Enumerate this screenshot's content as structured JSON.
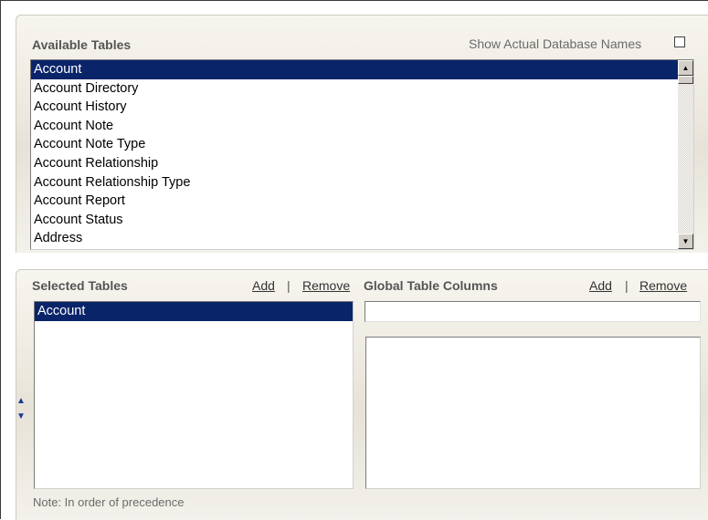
{
  "available_tables": {
    "heading": "Available Tables",
    "show_db_names_label": "Show Actual Database Names",
    "show_db_names_checked": false,
    "items": [
      "Account",
      "Account Directory",
      "Account History",
      "Account Note",
      "Account Note Type",
      "Account Relationship",
      "Account Relationship Type",
      "Account Report",
      "Account Status",
      "Address"
    ],
    "selected_index": 0
  },
  "selected_tables": {
    "heading": "Selected Tables",
    "add_label": "Add",
    "separator": "|",
    "remove_label": "Remove",
    "items": [
      "Account"
    ],
    "selected_index": 0,
    "note": "Note: In order of precedence"
  },
  "global_table_columns": {
    "heading": "Global Table Columns",
    "add_label": "Add",
    "separator": "|",
    "remove_label": "Remove",
    "input_value": "",
    "items": []
  },
  "icons": {
    "scroll_up": "scroll-up-arrow-icon",
    "scroll_down": "scroll-down-arrow-icon",
    "move_up": "move-up-arrow-icon",
    "move_down": "move-down-arrow-icon"
  },
  "colors": {
    "selection": "#0a246a",
    "move_arrows": "#1b3a8c"
  }
}
